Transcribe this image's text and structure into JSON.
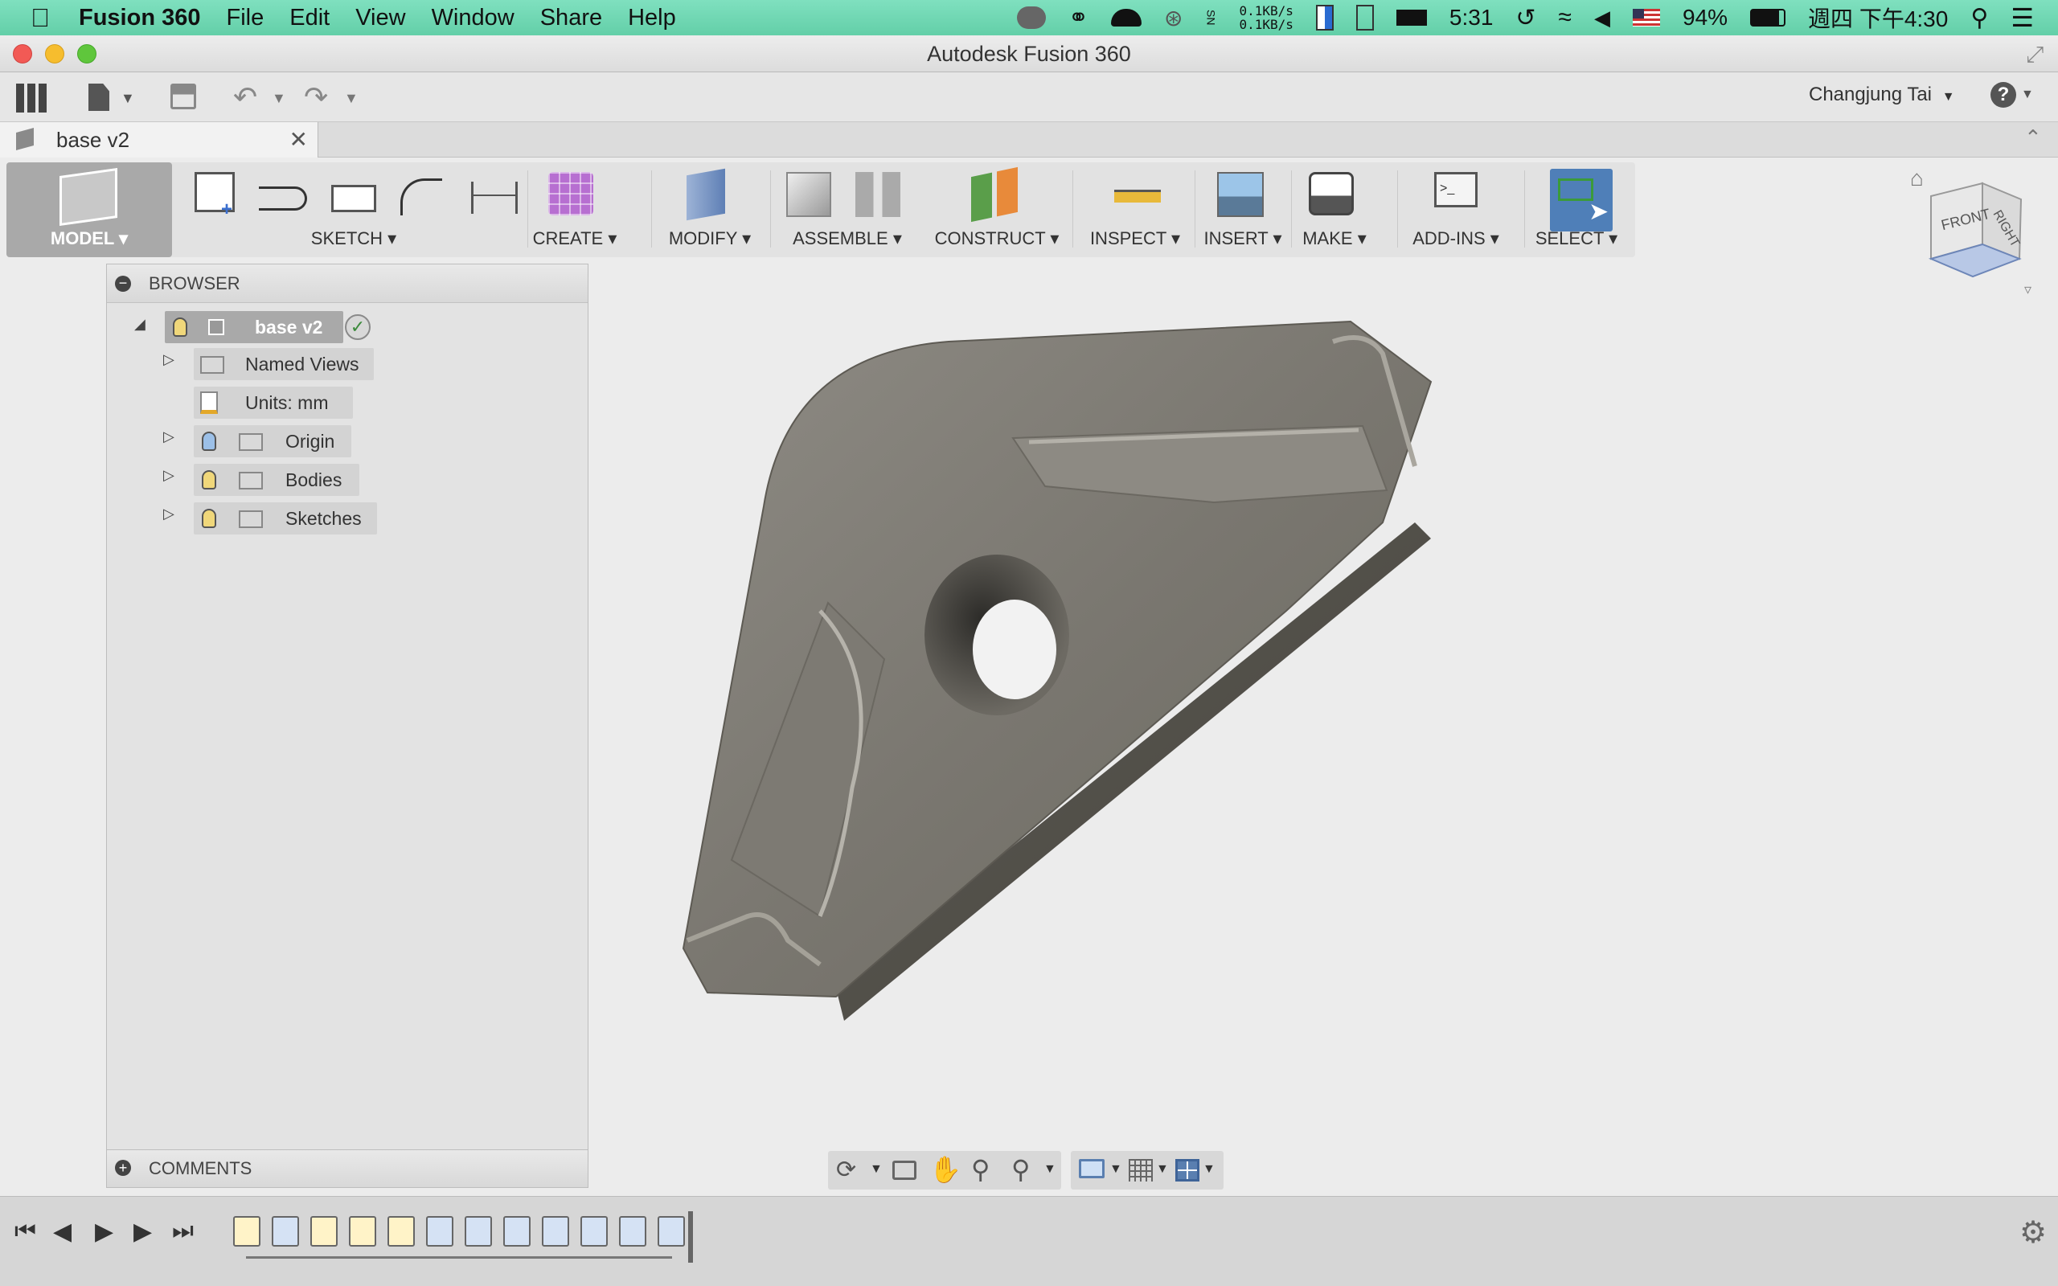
{
  "menubar": {
    "app": "Fusion 360",
    "menus": [
      "File",
      "Edit",
      "View",
      "Window",
      "Share",
      "Help"
    ],
    "net_up": "0.1KB/s",
    "net_down": "0.1KB/s",
    "battery_time": "5:31",
    "battery_pct": "94%",
    "clock": "週四 下午4:30"
  },
  "window": {
    "title": "Autodesk Fusion 360"
  },
  "apptoolbar": {
    "user": "Changjung Tai",
    "help": "?"
  },
  "doc_tab": {
    "title": "base v2"
  },
  "ribbon": {
    "workspace": "MODEL",
    "groups": [
      "SKETCH",
      "CREATE",
      "MODIFY",
      "ASSEMBLE",
      "CONSTRUCT",
      "INSPECT",
      "INSERT",
      "MAKE",
      "ADD-INS",
      "SELECT"
    ]
  },
  "browser": {
    "title": "BROWSER",
    "root": "base v2",
    "items": [
      "Named Views",
      "Units: mm",
      "Origin",
      "Bodies",
      "Sketches"
    ]
  },
  "comments": {
    "title": "COMMENTS"
  },
  "viewcube": {
    "front": "FRONT",
    "right": "RIGHT"
  },
  "colors": {
    "menubar": "#6fd8b3",
    "select_active": "#4f7fb8",
    "model_body": "#7e7b74"
  }
}
